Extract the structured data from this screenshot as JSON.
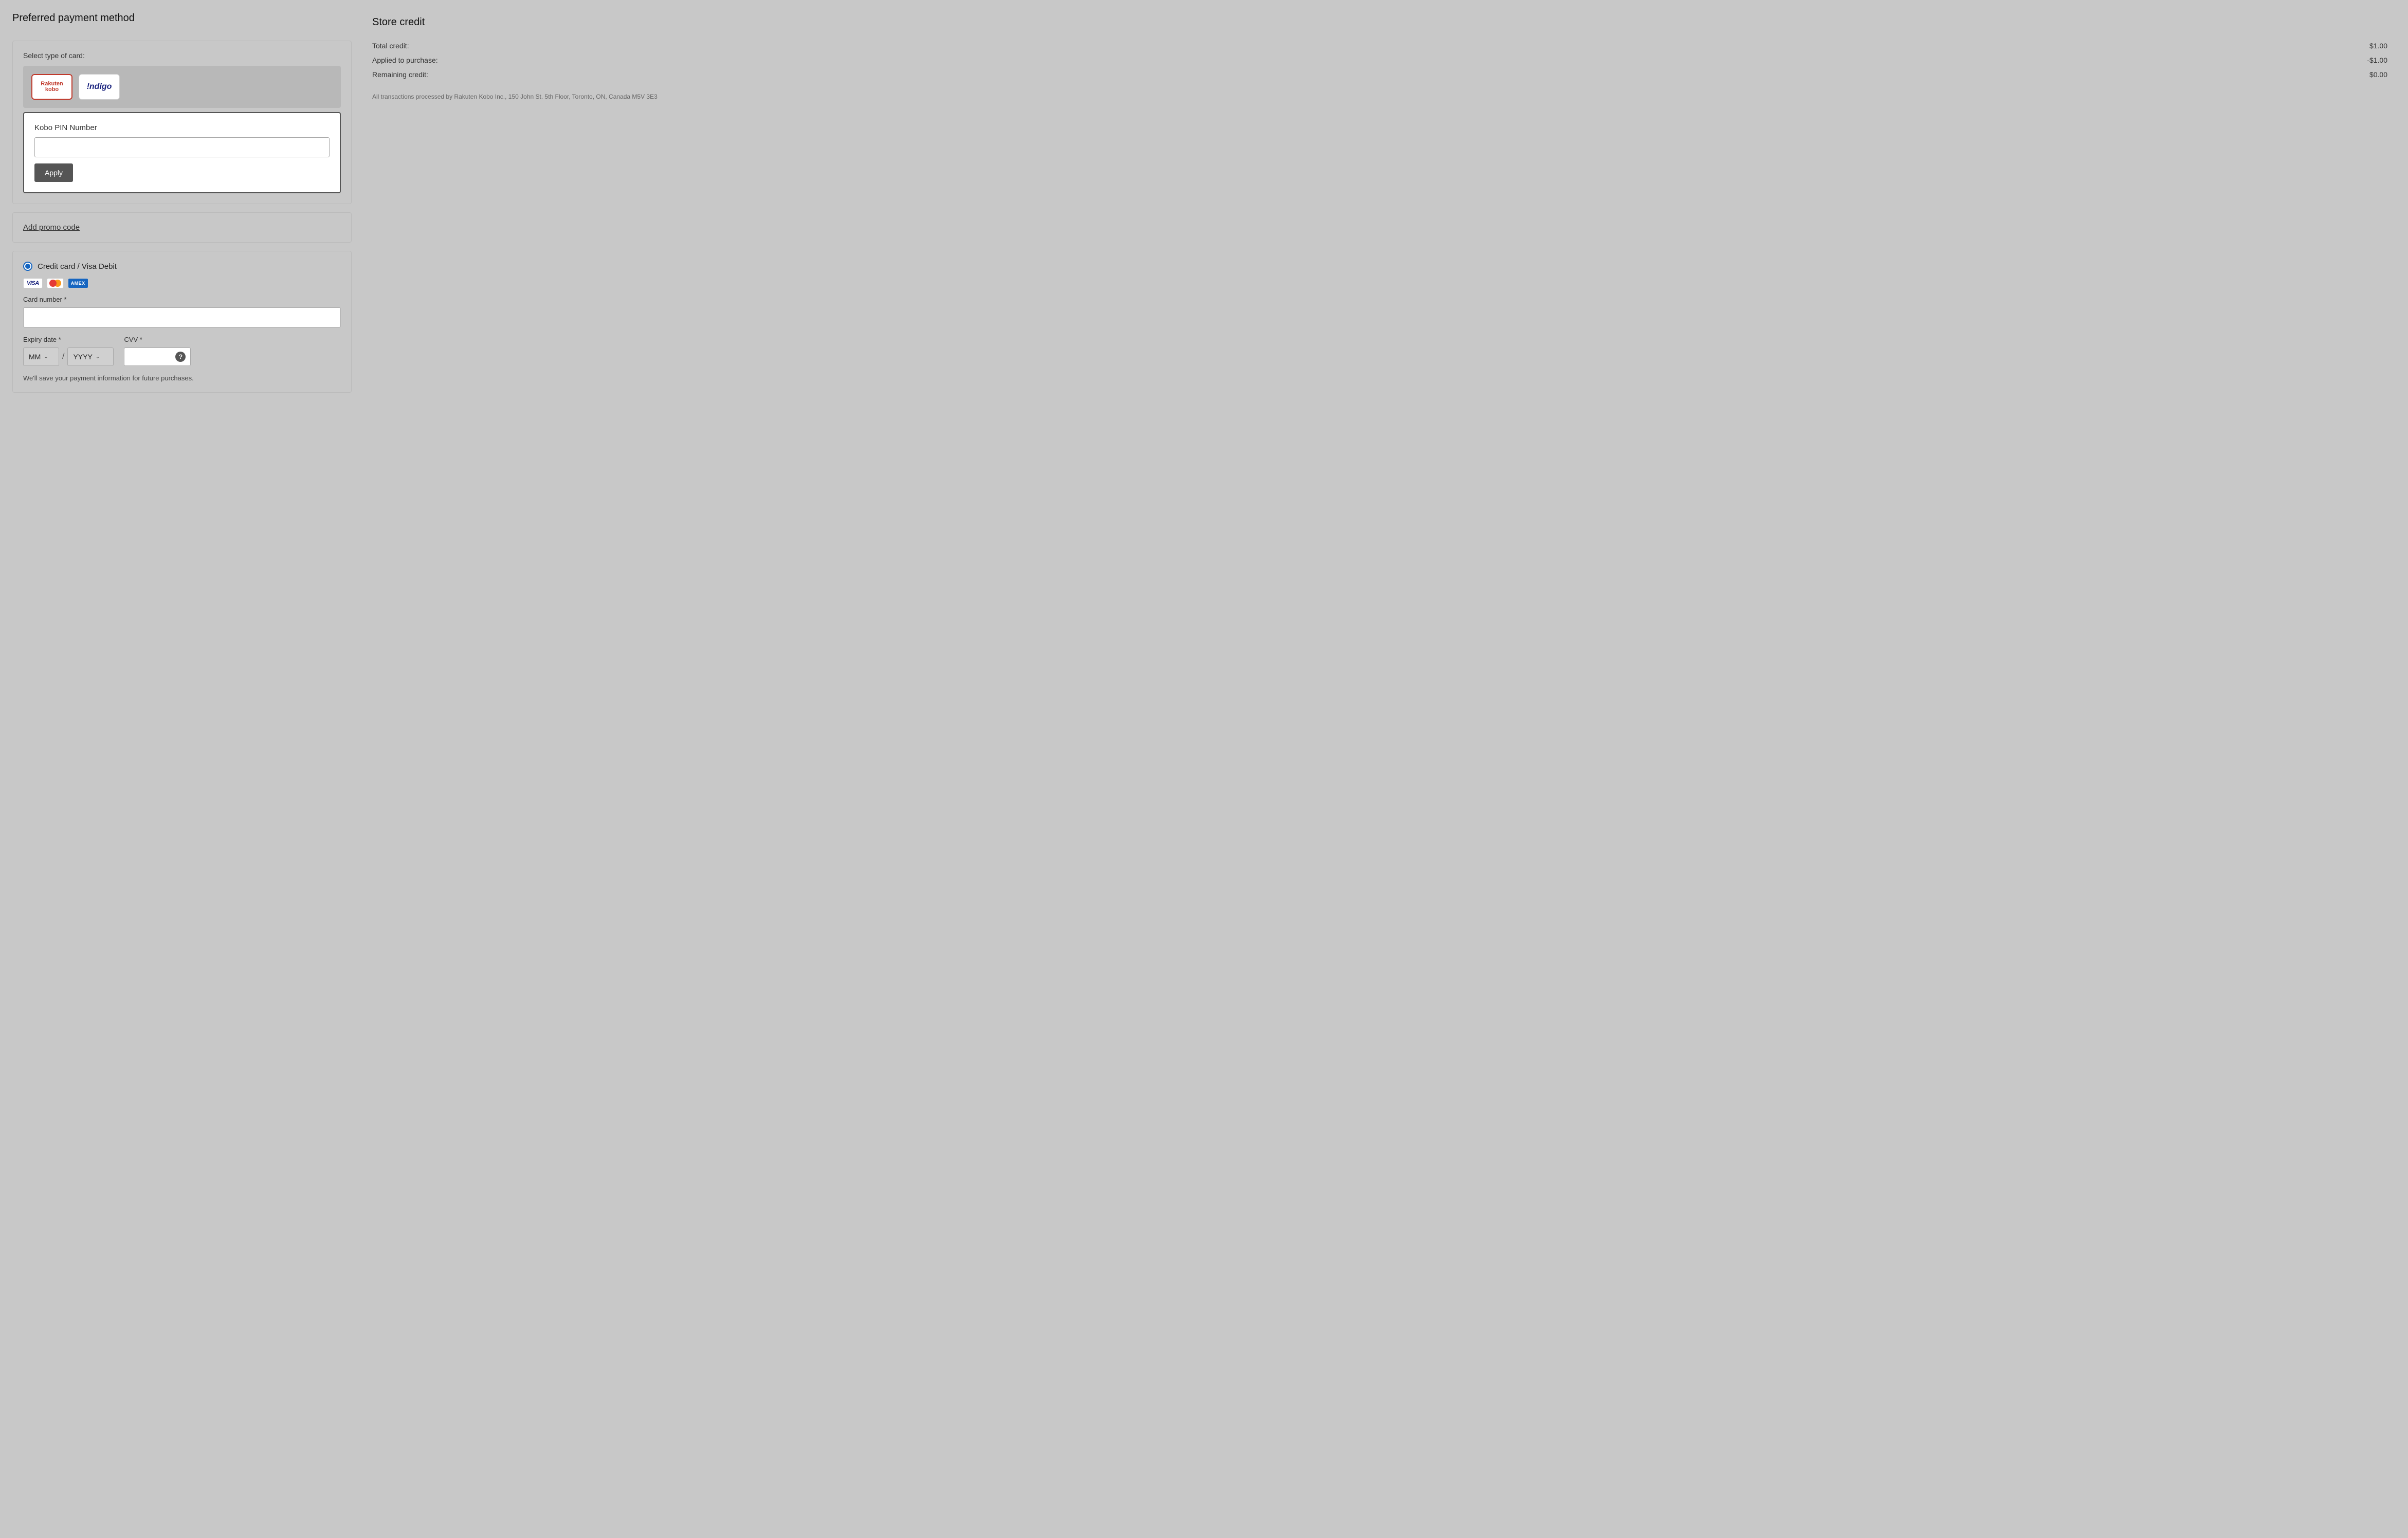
{
  "left": {
    "section_title": "Preferred payment method",
    "card_select_label": "Select type of card:",
    "card_options": [
      {
        "id": "rakuten-kobo",
        "label": "Rakuten kobo",
        "selected": true
      },
      {
        "id": "indigo",
        "label": "!ndigo",
        "selected": false
      }
    ],
    "pin_section": {
      "label": "Kobo PIN Number",
      "placeholder": "",
      "apply_button": "Apply"
    },
    "promo": {
      "link_text": "Add promo code"
    },
    "credit_card": {
      "option_label": "Credit card / Visa Debit",
      "card_number_label": "Card number *",
      "card_number_placeholder": "",
      "expiry_label": "Expiry date *",
      "expiry_month_placeholder": "MM",
      "expiry_year_placeholder": "YYYY",
      "cvv_label": "CVV *",
      "cvv_placeholder": "",
      "cvv_help": "?",
      "save_info": "We'll save your payment information for future purchases."
    }
  },
  "right": {
    "store_credit_title": "Store credit",
    "rows": [
      {
        "label": "Total credit:",
        "value": "$1.00"
      },
      {
        "label": "Applied to purchase:",
        "value": "-$1.00"
      },
      {
        "label": "Remaining credit:",
        "value": "$0.00"
      }
    ],
    "transactions_note": "All transactions processed by Rakuten Kobo Inc., 150 John St. 5th Floor, Toronto, ON, Canada M5V 3E3"
  }
}
